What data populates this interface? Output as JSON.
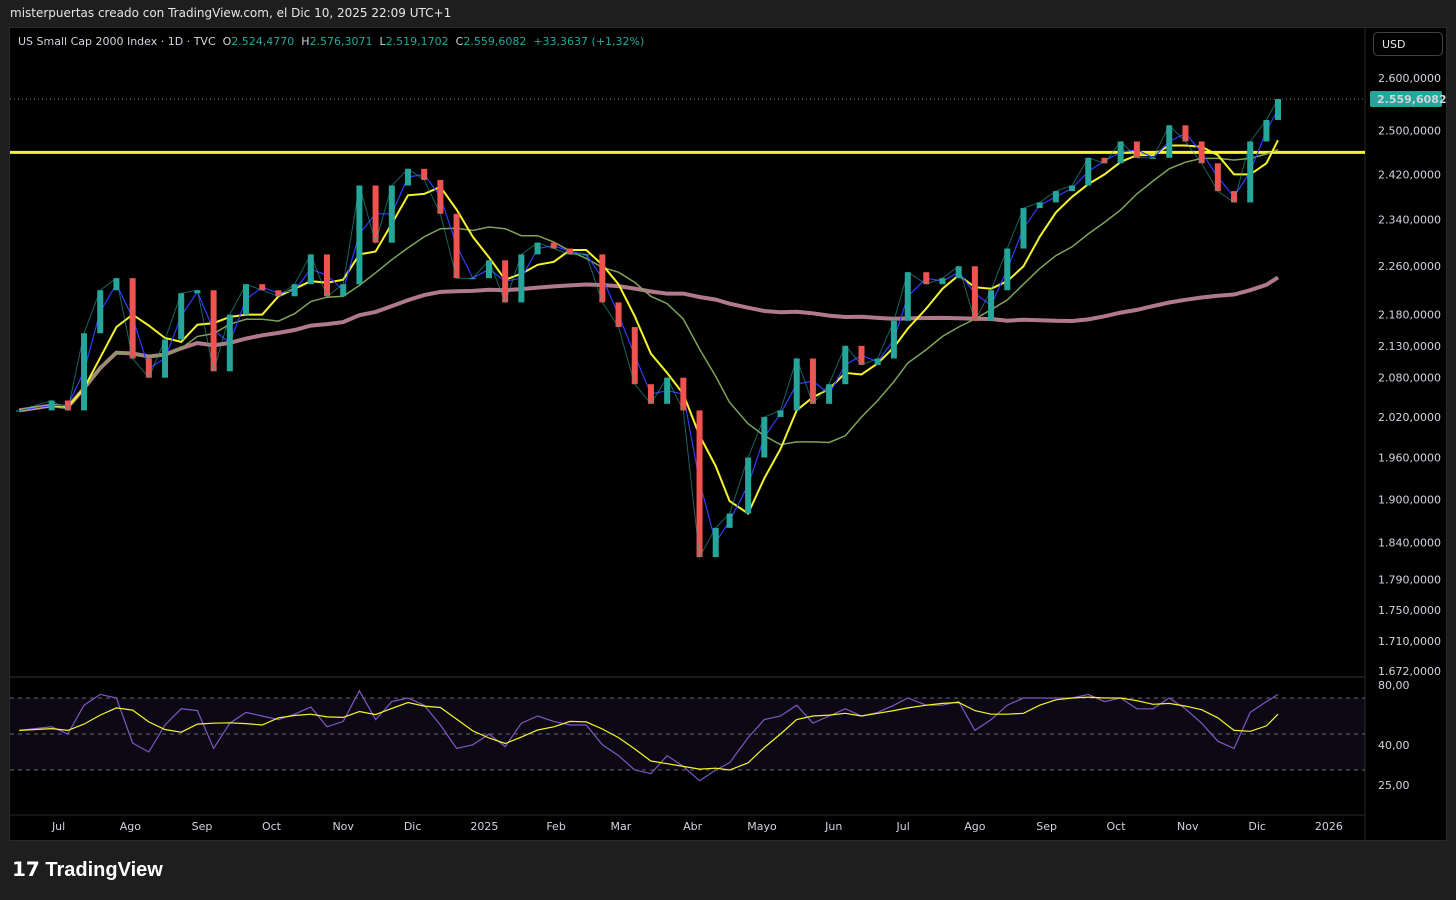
{
  "caption": "misterpuertas creado con TradingView.com, el Dic 10, 2025 22:09 UTC+1",
  "legend": {
    "symbol": "US Small Cap 2000 Index · 1D · TVC",
    "o_label": "O",
    "o": "2.524,4770",
    "h_label": "H",
    "h": "2.576,3071",
    "l_label": "L",
    "l": "2.519,1702",
    "c_label": "C",
    "c": "2.559,6082",
    "change": "+33,3637 (+1,32%)"
  },
  "currency": "USD",
  "logo": "TradingView",
  "colors": {
    "price": "#26a69a",
    "ma_fast": "#2f3cff",
    "ma_mid": "#f5f52a",
    "ma_slow": "#7fa35a",
    "ma_long": "#b07a8a",
    "hline": "#f5f52a",
    "rsi": "#7e57c2",
    "rsi_ma": "#f5f52a"
  },
  "chart_data": {
    "type": "line",
    "title": "US Small Cap 2000 Index · 1D · TVC",
    "scale": "log",
    "ylim": [
      1672,
      2600
    ],
    "last_price": 2559.6082,
    "last_price_label": "2.559,6082",
    "horizontal_line": 2460,
    "y_ticks": [
      {
        "v": 2600,
        "t": "2.600,0000"
      },
      {
        "v": 2500,
        "t": "2.500,0000"
      },
      {
        "v": 2420,
        "t": "2.420,0000"
      },
      {
        "v": 2340,
        "t": "2.340,0000"
      },
      {
        "v": 2260,
        "t": "2.260,0000"
      },
      {
        "v": 2180,
        "t": "2.180,0000"
      },
      {
        "v": 2130,
        "t": "2.130,0000"
      },
      {
        "v": 2080,
        "t": "2.080,0000"
      },
      {
        "v": 2020,
        "t": "2.020,0000"
      },
      {
        "v": 1960,
        "t": "1.960,0000"
      },
      {
        "v": 1900,
        "t": "1.900,0000"
      },
      {
        "v": 1840,
        "t": "1.840,0000"
      },
      {
        "v": 1790,
        "t": "1.790,0000"
      },
      {
        "v": 1750,
        "t": "1.750,0000"
      },
      {
        "v": 1710,
        "t": "1.710,0000"
      },
      {
        "v": 1672,
        "t": "1.672,0000"
      }
    ],
    "x_ticks": [
      {
        "d": "2024-07-01",
        "t": "Jul"
      },
      {
        "d": "2024-08-01",
        "t": "Ago"
      },
      {
        "d": "2024-09-01",
        "t": "Sep"
      },
      {
        "d": "2024-10-01",
        "t": "Oct"
      },
      {
        "d": "2024-11-01",
        "t": "Nov"
      },
      {
        "d": "2024-12-01",
        "t": "Dic"
      },
      {
        "d": "2025-01-01",
        "t": "2025"
      },
      {
        "d": "2025-02-01",
        "t": "Feb"
      },
      {
        "d": "2025-03-01",
        "t": "Mar"
      },
      {
        "d": "2025-04-01",
        "t": "Abr"
      },
      {
        "d": "2025-05-01",
        "t": "Mayo"
      },
      {
        "d": "2025-06-01",
        "t": "Jun"
      },
      {
        "d": "2025-07-01",
        "t": "Jul"
      },
      {
        "d": "2025-08-01",
        "t": "Ago"
      },
      {
        "d": "2025-09-01",
        "t": "Sep"
      },
      {
        "d": "2025-10-01",
        "t": "Oct"
      },
      {
        "d": "2025-11-01",
        "t": "Nov"
      },
      {
        "d": "2025-12-01",
        "t": "Dic"
      },
      {
        "d": "2026-01-01",
        "t": "2026"
      }
    ],
    "x_range": [
      "2024-06-10",
      "2025-12-10"
    ],
    "ma_periods": {
      "fast": 2,
      "mid": 4,
      "slow": 10,
      "long": 40
    },
    "dates": [
      "2024-06-14",
      "2024-06-28",
      "2024-07-05",
      "2024-07-12",
      "2024-07-19",
      "2024-07-26",
      "2024-08-02",
      "2024-08-09",
      "2024-08-16",
      "2024-08-23",
      "2024-08-30",
      "2024-09-06",
      "2024-09-13",
      "2024-09-20",
      "2024-09-27",
      "2024-10-04",
      "2024-10-11",
      "2024-10-18",
      "2024-10-25",
      "2024-11-01",
      "2024-11-08",
      "2024-11-15",
      "2024-11-22",
      "2024-11-29",
      "2024-12-06",
      "2024-12-13",
      "2024-12-20",
      "2024-12-27",
      "2025-01-03",
      "2025-01-10",
      "2025-01-17",
      "2025-01-24",
      "2025-01-31",
      "2025-02-07",
      "2025-02-14",
      "2025-02-21",
      "2025-02-28",
      "2025-03-07",
      "2025-03-14",
      "2025-03-21",
      "2025-03-28",
      "2025-04-04",
      "2025-04-11",
      "2025-04-17",
      "2025-04-25",
      "2025-05-02",
      "2025-05-09",
      "2025-05-16",
      "2025-05-23",
      "2025-05-30",
      "2025-06-06",
      "2025-06-13",
      "2025-06-20",
      "2025-06-27",
      "2025-07-03",
      "2025-07-11",
      "2025-07-18",
      "2025-07-25",
      "2025-08-01",
      "2025-08-08",
      "2025-08-15",
      "2025-08-22",
      "2025-08-29",
      "2025-09-05",
      "2025-09-12",
      "2025-09-19",
      "2025-09-26",
      "2025-10-03",
      "2025-10-10",
      "2025-10-17",
      "2025-10-24",
      "2025-10-31",
      "2025-11-07",
      "2025-11-14",
      "2025-11-21",
      "2025-11-28",
      "2025-12-05",
      "2025-12-10"
    ],
    "close": [
      2030,
      2045,
      2030,
      2150,
      2220,
      2240,
      2110,
      2080,
      2140,
      2215,
      2220,
      2090,
      2180,
      2230,
      2220,
      2210,
      2230,
      2280,
      2210,
      2230,
      2400,
      2300,
      2400,
      2430,
      2410,
      2350,
      2240,
      2240,
      2270,
      2200,
      2280,
      2300,
      2290,
      2280,
      2280,
      2200,
      2160,
      2070,
      2040,
      2080,
      2030,
      1820,
      1860,
      1880,
      1960,
      2020,
      2030,
      2110,
      2040,
      2070,
      2130,
      2100,
      2110,
      2170,
      2250,
      2230,
      2240,
      2260,
      2170,
      2220,
      2290,
      2360,
      2370,
      2390,
      2400,
      2450,
      2440,
      2480,
      2450,
      2450,
      2510,
      2480,
      2440,
      2390,
      2370,
      2480,
      2520,
      2559.6
    ],
    "rsi": {
      "ylim": [
        20,
        85
      ],
      "levels": [
        70,
        50,
        30
      ],
      "ticks": [
        {
          "v": 80,
          "t": "80,00"
        },
        {
          "v": 40,
          "t": "40,00"
        },
        {
          "v": 25,
          "t": "25,00"
        }
      ],
      "values": [
        52,
        54,
        50,
        66,
        72,
        70,
        45,
        40,
        55,
        64,
        63,
        42,
        56,
        62,
        60,
        58,
        61,
        65,
        54,
        57,
        74,
        58,
        68,
        70,
        66,
        55,
        42,
        44,
        50,
        43,
        56,
        60,
        57,
        55,
        55,
        44,
        38,
        30,
        28,
        38,
        32,
        24,
        30,
        34,
        48,
        58,
        60,
        66,
        56,
        60,
        64,
        60,
        62,
        66,
        70,
        66,
        66,
        68,
        52,
        58,
        66,
        70,
        70,
        70,
        70,
        72,
        68,
        70,
        64,
        64,
        70,
        64,
        56,
        46,
        42,
        62,
        68,
        72
      ]
    }
  }
}
